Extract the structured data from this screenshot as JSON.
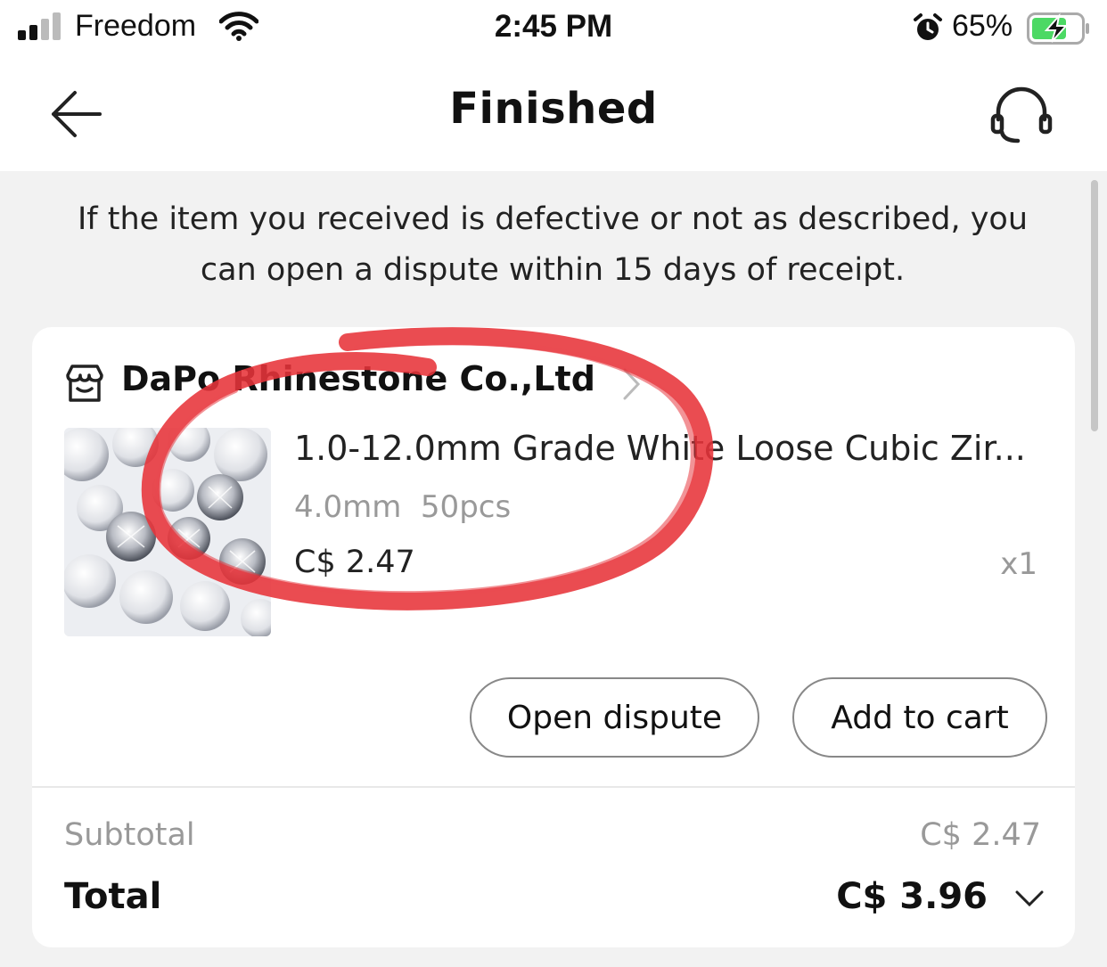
{
  "status_bar": {
    "carrier": "Freedom",
    "time": "2:45 PM",
    "battery_percent": "65%",
    "icons": [
      "signal-icon",
      "wifi-icon",
      "alarm-icon",
      "battery-charging-icon"
    ]
  },
  "nav": {
    "title": "Finished",
    "back_icon": "arrow-left-icon",
    "support_icon": "headset-icon"
  },
  "notice": {
    "text": "If the item you received is defective or not as described, you can open a dispute within 15 days of receipt."
  },
  "order": {
    "store_name": "DaPo Rhinestone Co.,Ltd",
    "store_icon": "store-icon",
    "product": {
      "title": "1.0-12.0mm Grade White Loose Cubic Zir...",
      "sku": "4.0mm  50pcs",
      "price": "C$ 2.47",
      "quantity": "x1"
    },
    "actions": {
      "open_dispute": "Open dispute",
      "add_to_cart": "Add to cart"
    },
    "summary": {
      "subtotal_label": "Subtotal",
      "subtotal_value": "C$ 2.47",
      "total_label": "Total",
      "total_value": "C$ 3.96"
    }
  },
  "colors": {
    "background": "#f2f2f2",
    "annotation_red": "#e8343a",
    "battery_green": "#4cd964"
  }
}
